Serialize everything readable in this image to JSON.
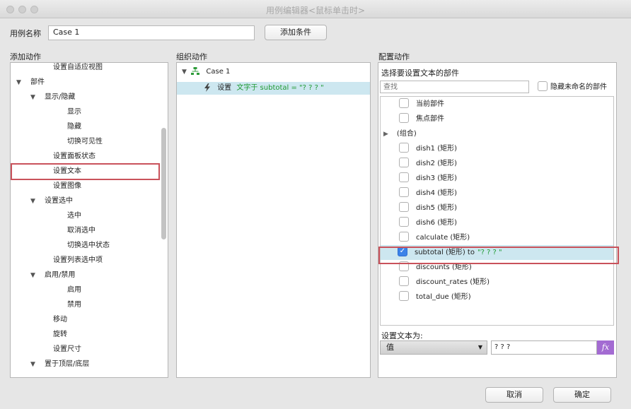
{
  "window": {
    "title": "用例编辑器<鼠标单击时>"
  },
  "case_name": {
    "label": "用例名称",
    "value": "Case 1"
  },
  "add_condition": "添加条件",
  "sections": {
    "add_action": "添加动作",
    "organize_action": "组织动作",
    "configure_action": "配置动作"
  },
  "actions": [
    {
      "label": "设置自适应视图",
      "arrow": ""
    },
    {
      "label": "部件",
      "arrow": "▼"
    },
    {
      "label": "显示/隐藏",
      "arrow": "▼"
    },
    {
      "label": "显示",
      "arrow": ""
    },
    {
      "label": "隐藏",
      "arrow": ""
    },
    {
      "label": "切换可见性",
      "arrow": ""
    },
    {
      "label": "设置面板状态",
      "arrow": ""
    },
    {
      "label": "设置文本",
      "arrow": ""
    },
    {
      "label": "设置图像",
      "arrow": ""
    },
    {
      "label": "设置选中",
      "arrow": "▼"
    },
    {
      "label": "选中",
      "arrow": ""
    },
    {
      "label": "取消选中",
      "arrow": ""
    },
    {
      "label": "切换选中状态",
      "arrow": ""
    },
    {
      "label": "设置列表选中项",
      "arrow": ""
    },
    {
      "label": "启用/禁用",
      "arrow": "▼"
    },
    {
      "label": "启用",
      "arrow": ""
    },
    {
      "label": "禁用",
      "arrow": ""
    },
    {
      "label": "移动",
      "arrow": ""
    },
    {
      "label": "旋转",
      "arrow": ""
    },
    {
      "label": "设置尺寸",
      "arrow": ""
    },
    {
      "label": "置于顶层/底层",
      "arrow": "▼"
    }
  ],
  "organize": {
    "case_arrow": "▼",
    "case_label": "Case 1",
    "action_prefix": "设置",
    "action_detail": "文字于 subtotal = \"? ? ? \""
  },
  "config": {
    "select_widget_label": "选择要设置文本的部件",
    "search_placeholder": "查找",
    "hide_unnamed_label": "隐藏未命名的部件",
    "widgets": [
      {
        "label": "当前部件",
        "checked": false,
        "suffix": ""
      },
      {
        "label": "焦点部件",
        "checked": false,
        "suffix": ""
      },
      {
        "label": "(组合)",
        "group": true,
        "arrow": "▶"
      },
      {
        "label": "dish1 (矩形)",
        "checked": false,
        "suffix": ""
      },
      {
        "label": "dish2 (矩形)",
        "checked": false,
        "suffix": ""
      },
      {
        "label": "dish3 (矩形)",
        "checked": false,
        "suffix": ""
      },
      {
        "label": "dish4 (矩形)",
        "checked": false,
        "suffix": ""
      },
      {
        "label": "dish5 (矩形)",
        "checked": false,
        "suffix": ""
      },
      {
        "label": "dish6 (矩形)",
        "checked": false,
        "suffix": ""
      },
      {
        "label": "calculate (矩形)",
        "checked": false,
        "suffix": ""
      },
      {
        "label": "subtotal (矩形) to",
        "checked": true,
        "suffix": "\"? ? ? \""
      },
      {
        "label": "discounts (矩形)",
        "checked": false,
        "suffix": ""
      },
      {
        "label": "discount_rates (矩形)",
        "checked": false,
        "suffix": ""
      },
      {
        "label": "total_due (矩形)",
        "checked": false,
        "suffix": ""
      }
    ],
    "set_text_label": "设置文本为:",
    "type_select": "值",
    "value": "? ? ?",
    "fx": "fx"
  },
  "buttons": {
    "cancel": "取消",
    "ok": "确定"
  },
  "colors": {
    "highlight_border": "#c9525b",
    "selection": "#cde7f0",
    "checked": "#3b82e8",
    "action_detail": "#1f9a32",
    "fx_bg": "#a36bd2"
  }
}
